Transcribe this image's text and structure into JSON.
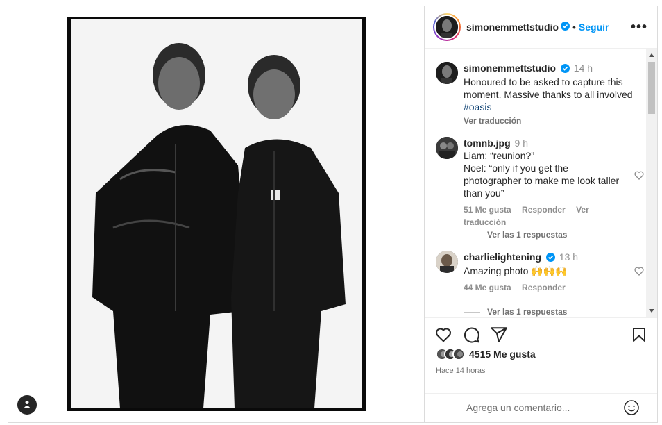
{
  "post": {
    "author": "simonemmettstudio",
    "follow_label": "Seguir",
    "more_label": "•••",
    "caption": {
      "time": "14 h",
      "text": "Honoured to be asked to capture this moment. Massive thanks to all involved",
      "hashtag": "#oasis",
      "translate": "Ver traducción"
    }
  },
  "comments": [
    {
      "user": "tomnb.jpg",
      "time": "9 h",
      "lines": [
        "Liam: “reunion?”",
        "Noel: “only if you get the photographer to make me look taller than you”"
      ],
      "likes": "51 Me gusta",
      "reply": "Responder",
      "translate": "Ver traducción",
      "replies": "Ver las 1 respuestas"
    },
    {
      "user": "charlielightening",
      "time": "13 h",
      "text": "Amazing photo 🙌🙌🙌",
      "likes": "44 Me gusta",
      "reply": "Responder",
      "replies": "Ver las 1 respuestas"
    }
  ],
  "footer": {
    "likes_count": "4515 Me gusta",
    "posted_ago": "Hace 14 horas",
    "comment_placeholder": "Agrega un comentario..."
  },
  "colors": {
    "link_blue": "#0095f6",
    "hashtag": "#00376b",
    "muted": "#737373"
  },
  "icons": [
    "heart-icon",
    "comment-icon",
    "share-icon",
    "bookmark-icon",
    "emoji-icon",
    "user-tag-icon",
    "verified-icon",
    "more-icon"
  ]
}
